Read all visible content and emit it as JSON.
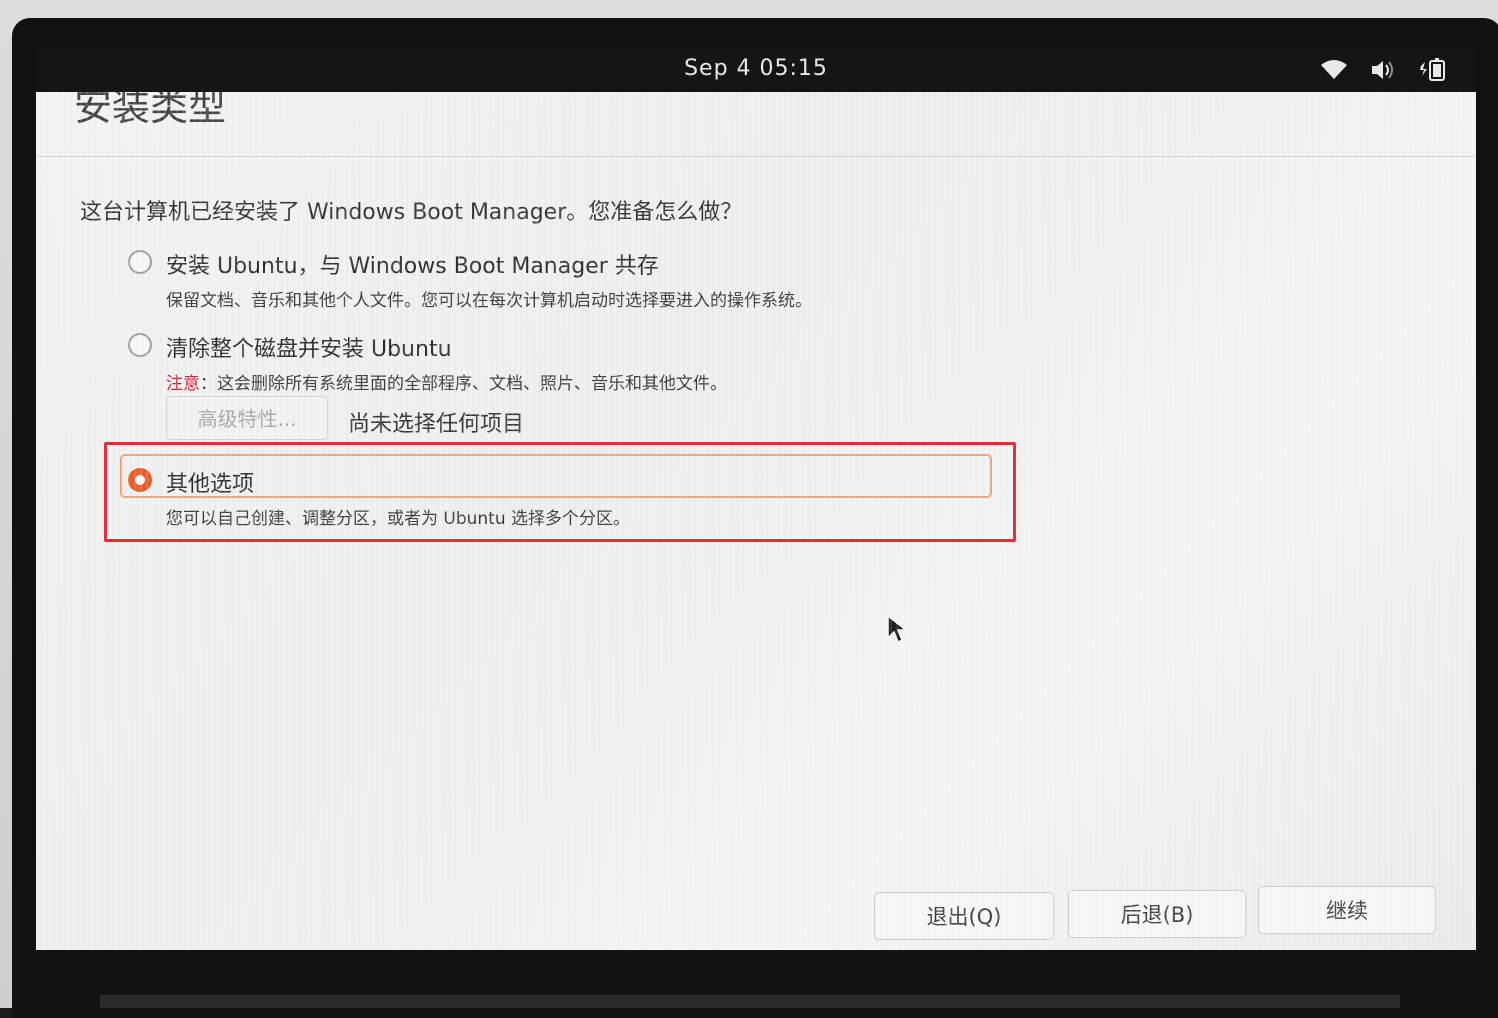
{
  "topbar": {
    "clock": "Sep 4  05:15",
    "tray_icons": [
      "wifi-icon",
      "volume-icon",
      "battery-icon"
    ]
  },
  "window": {
    "title": "安装类型",
    "question": "这台计算机已经安装了 Windows Boot Manager。您准备怎么做？"
  },
  "options": [
    {
      "label": "安装 Ubuntu，与 Windows Boot Manager 共存",
      "description": "保留文档、音乐和其他个人文件。您可以在每次计算机启动时选择要进入的操作系统。",
      "selected": false
    },
    {
      "label": "清除整个磁盘并安装 Ubuntu",
      "warning_prefix": "注意",
      "description": "：这会删除所有系统里面的全部程序、文档、照片、音乐和其他文件。",
      "selected": false
    },
    {
      "label": "其他选项",
      "description": "您可以自己创建、调整分区，或者为 Ubuntu 选择多个分区。",
      "selected": true
    }
  ],
  "advanced": {
    "button_label": "高级特性...",
    "status": "尚未选择任何项目"
  },
  "buttons": {
    "quit": "退出(Q)",
    "back": "后退(B)",
    "continue": "继续"
  },
  "colors": {
    "accent": "#e95420",
    "highlight_box": "#e62e3a",
    "warning": "#c7162b"
  }
}
